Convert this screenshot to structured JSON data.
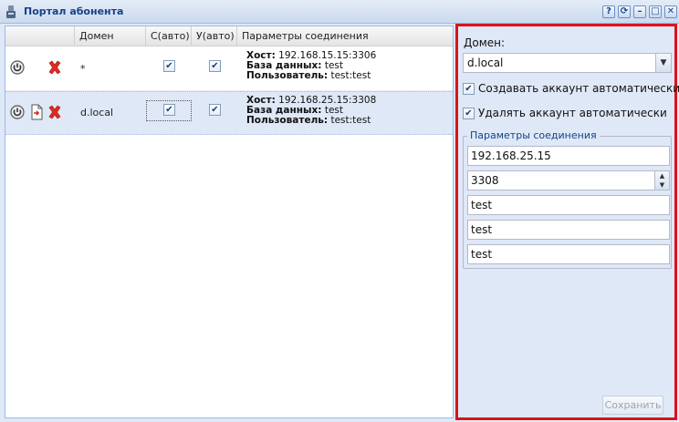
{
  "window": {
    "title": "Портал абонента",
    "buttons": [
      {
        "name": "help-button",
        "glyph": "?"
      },
      {
        "name": "refresh-button",
        "glyph": "⟳"
      },
      {
        "name": "minimize-button",
        "glyph": "–"
      },
      {
        "name": "maximize-button",
        "glyph": "□"
      },
      {
        "name": "close-button",
        "glyph": "✕"
      }
    ]
  },
  "grid": {
    "columns": [
      "",
      "Домен",
      "С(авто)",
      "У(авто)",
      "Параметры соединения"
    ],
    "rows": [
      {
        "domain": "*",
        "create_auto": true,
        "delete_auto": true,
        "host_label": "Хост:",
        "host": "192.168.15.15:3306",
        "db_label": "База данных:",
        "db": "test",
        "user_label": "Пользователь:",
        "user": "test:test",
        "selected": false
      },
      {
        "domain": "d.local",
        "create_auto": true,
        "delete_auto": true,
        "host_label": "Хост:",
        "host": "192.168.25.15:3308",
        "db_label": "База данных:",
        "db": "test",
        "user_label": "Пользователь:",
        "user": "test:test",
        "selected": true
      }
    ]
  },
  "form": {
    "domain_label": "Домен:",
    "domain_value": "d.local",
    "create_auto_label": "Создавать аккаунт автоматически",
    "create_auto_checked": true,
    "delete_auto_label": "Удалять аккаунт автоматически",
    "delete_auto_checked": true,
    "connection_legend": "Параметры соединения",
    "host": "192.168.25.15",
    "port": "3308",
    "database": "test",
    "user": "test",
    "password": "test",
    "save_label": "Сохранить"
  },
  "colors": {
    "accent_border": "#d8141b",
    "title_text": "#15428b",
    "delete_icon": "#e02a1f"
  }
}
